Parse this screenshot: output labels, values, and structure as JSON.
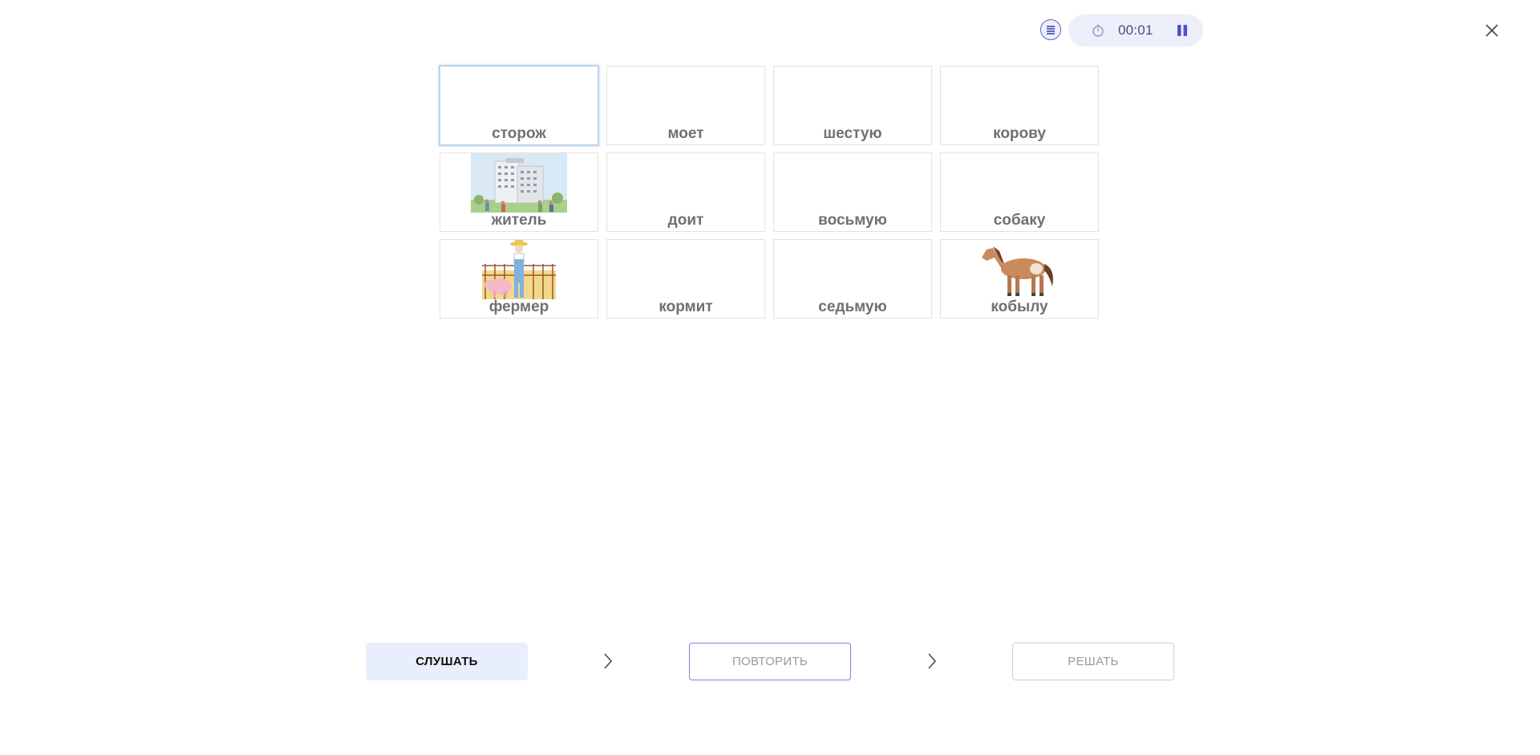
{
  "toolbar": {
    "menu_icon": "list-icon",
    "timer_icon": "stopwatch-icon",
    "time": "00:01",
    "pause_icon": "pause-icon",
    "close_icon": "close-icon",
    "accent_color": "#5b63c9"
  },
  "grid": {
    "rows": [
      [
        "сторож",
        "моет",
        "шестую",
        "корову"
      ],
      [
        "житель",
        "доит",
        "восьмую",
        "собаку"
      ],
      [
        "фермер",
        "кормит",
        "седьмую",
        "кобылу"
      ]
    ],
    "selected": "сторож",
    "images": {
      "житель": "apartment-building-with-people-image",
      "фермер": "farmer-with-pig-image",
      "кобылу": "horse-image"
    }
  },
  "steps": {
    "listen": "СЛУШАТЬ",
    "repeat": "ПОВТОРИТЬ",
    "solve": "РЕШАТЬ",
    "arrow_icon": "chevron-right-icon"
  }
}
